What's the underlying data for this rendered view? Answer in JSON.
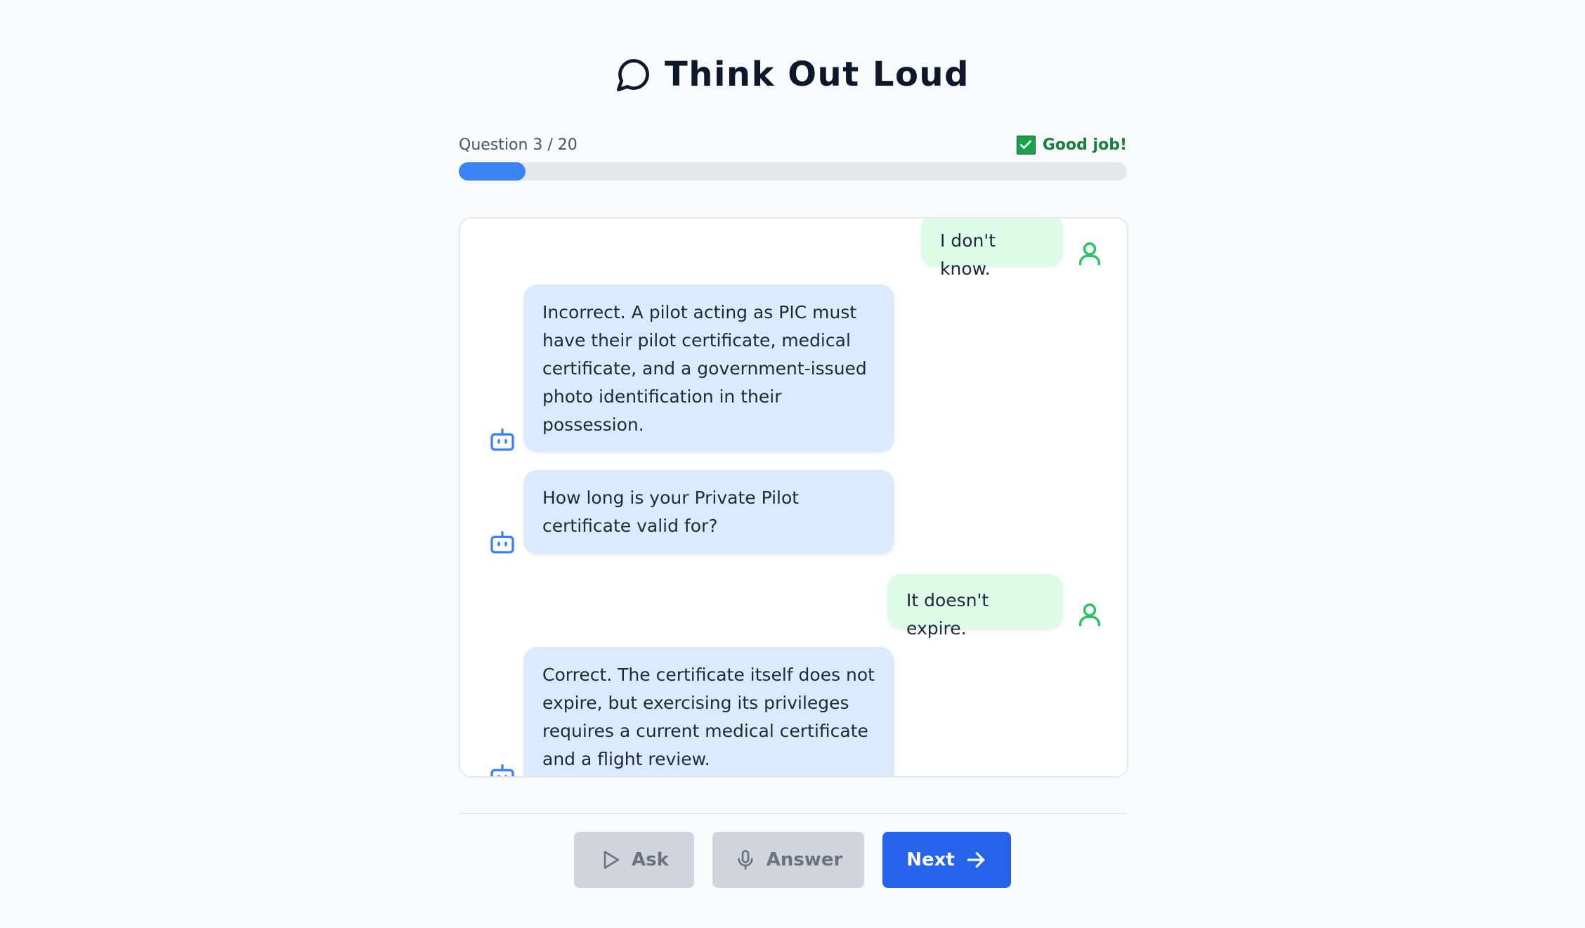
{
  "app": {
    "title": "Think Out Loud",
    "logo_icon": "chat-bubble-icon"
  },
  "progress": {
    "label": "Question 3 / 20",
    "current": 3,
    "total": 20,
    "fraction": 0.1,
    "status_icon": "checkbox-checked-icon",
    "status_text": "Good job!",
    "accent_color": "#3b82f6",
    "status_color": "#15803d"
  },
  "messages": [
    {
      "role": "user",
      "text": "I don't know.",
      "icon": "user-icon"
    },
    {
      "role": "bot",
      "text": "Incorrect. A pilot acting as PIC must have their pilot certificate, medical certificate, and a government-issued photo identification in their possession.",
      "icon": "robot-icon"
    },
    {
      "role": "bot",
      "text": "How long is your Private Pilot certificate valid for?",
      "icon": "robot-icon"
    },
    {
      "role": "user",
      "text": "It doesn't expire.",
      "icon": "user-icon"
    },
    {
      "role": "bot",
      "text": "Correct. The certificate itself does not expire, but exercising its privileges requires a current medical certificate and a flight review.",
      "icon": "robot-icon"
    }
  ],
  "colors": {
    "bot_bubble": "#dbeafe",
    "user_bubble": "#dcfce7",
    "bot_icon": "#3b82f6",
    "user_icon": "#22c55e"
  },
  "controls": {
    "ask_label": "Ask",
    "ask_icon": "play-icon",
    "answer_label": "Answer",
    "answer_icon": "microphone-icon",
    "next_label": "Next",
    "next_icon": "arrow-right-icon"
  }
}
